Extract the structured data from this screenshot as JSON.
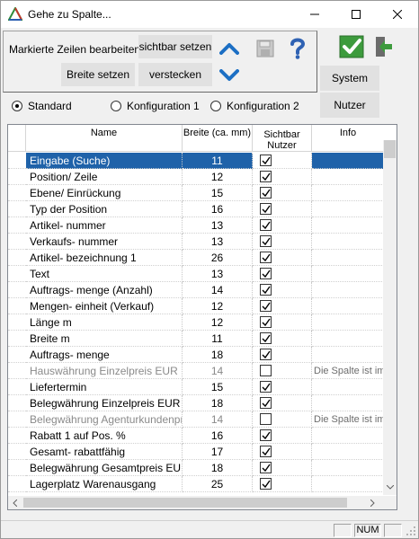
{
  "window": {
    "title": "Gehe zu Spalte...",
    "accent": "#1f62a9"
  },
  "toolbar": {
    "mark_label": "Markierte Zeilen bearbeiten:",
    "set_visible": "sichtbar setzen",
    "set_width": "Breite setzen",
    "hide": "verstecken",
    "system": "System",
    "user": "Nutzer"
  },
  "configs": [
    {
      "label": "Standard",
      "selected": true
    },
    {
      "label": "Konfiguration 1",
      "selected": false
    },
    {
      "label": "Konfiguration 2",
      "selected": false
    }
  ],
  "table": {
    "headers": {
      "name": "Name",
      "width": "Breite (ca. mm)",
      "visible_line1": "Sichtbar",
      "visible_line2": "Nutzer",
      "info": "Info"
    },
    "rows": [
      {
        "name": "Eingabe (Suche)",
        "width": "11",
        "visible": true,
        "info": "",
        "selected": true
      },
      {
        "name": "Position/ Zeile",
        "width": "12",
        "visible": true,
        "info": ""
      },
      {
        "name": "Ebene/ Einrückung",
        "width": "15",
        "visible": true,
        "info": ""
      },
      {
        "name": "Typ der Position",
        "width": "16",
        "visible": true,
        "info": ""
      },
      {
        "name": "Artikel- nummer",
        "width": "13",
        "visible": true,
        "info": ""
      },
      {
        "name": "Verkaufs- nummer",
        "width": "13",
        "visible": true,
        "info": ""
      },
      {
        "name": "Artikel- bezeichnung 1",
        "width": "26",
        "visible": true,
        "info": ""
      },
      {
        "name": "Text",
        "width": "13",
        "visible": true,
        "info": ""
      },
      {
        "name": "Auftrags- menge (Anzahl)",
        "width": "14",
        "visible": true,
        "info": ""
      },
      {
        "name": "Mengen- einheit (Verkauf)",
        "width": "12",
        "visible": true,
        "info": ""
      },
      {
        "name": "Länge m",
        "width": "12",
        "visible": true,
        "info": ""
      },
      {
        "name": "Breite m",
        "width": "11",
        "visible": true,
        "info": ""
      },
      {
        "name": "Auftrags- menge",
        "width": "18",
        "visible": true,
        "info": ""
      },
      {
        "name": "Hauswährung Einzelpreis EUR",
        "width": "14",
        "visible": false,
        "info": "Die Spalte ist im",
        "dim": true
      },
      {
        "name": "Liefertermin",
        "width": "15",
        "visible": true,
        "info": ""
      },
      {
        "name": "Belegwährung Einzelpreis EUR",
        "width": "18",
        "visible": true,
        "info": ""
      },
      {
        "name": "Belegwährung Agenturkundenpreis",
        "width": "14",
        "visible": false,
        "info": "Die Spalte ist im",
        "dim": true
      },
      {
        "name": "Rabatt 1 auf Pos. %",
        "width": "16",
        "visible": true,
        "info": ""
      },
      {
        "name": "Gesamt- rabattfähig",
        "width": "17",
        "visible": true,
        "info": ""
      },
      {
        "name": "Belegwährung Gesamtpreis EUR",
        "width": "18",
        "visible": true,
        "info": ""
      },
      {
        "name": "Lagerplatz Warenausgang",
        "width": "25",
        "visible": true,
        "info": ""
      }
    ]
  },
  "status": {
    "num": "NUM"
  }
}
